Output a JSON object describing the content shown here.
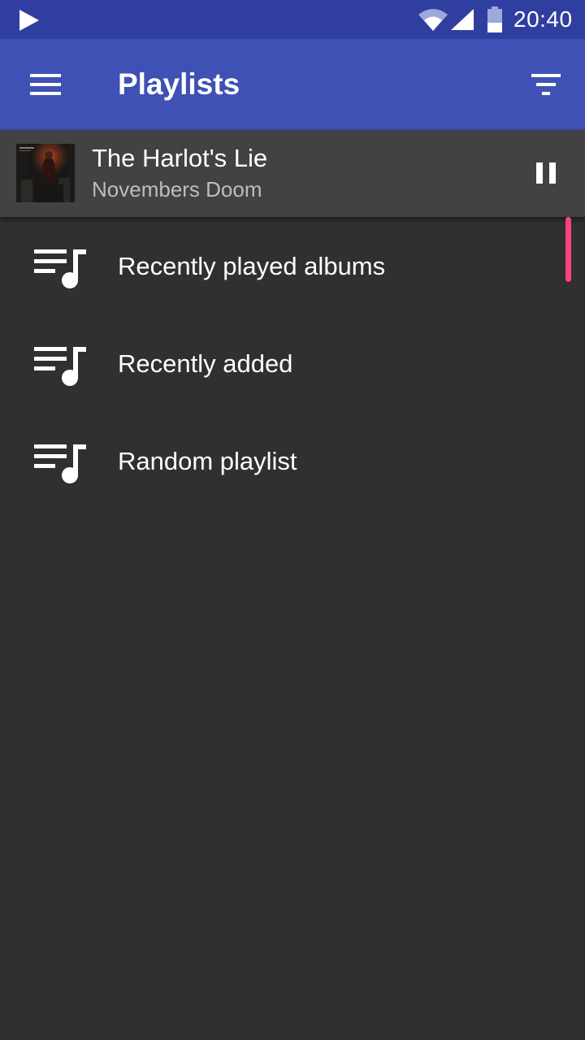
{
  "status_bar": {
    "time": "20:40",
    "icons": [
      "play-notification-icon",
      "wifi-icon",
      "signal-icon",
      "battery-icon"
    ]
  },
  "toolbar": {
    "title": "Playlists",
    "menu_icon": "hamburger-menu-icon",
    "sort_icon": "sort-filter-icon"
  },
  "now_playing": {
    "title": "The Harlot's Lie",
    "artist": "Novembers Doom",
    "control_icon": "pause-icon"
  },
  "playlists": [
    {
      "label": "Recently played albums",
      "icon": "playlist-music-icon"
    },
    {
      "label": "Recently added",
      "icon": "playlist-music-icon"
    },
    {
      "label": "Random playlist",
      "icon": "playlist-music-icon"
    }
  ],
  "colors": {
    "status_bar": "#303f9f",
    "toolbar": "#3f51b5",
    "background": "#303030",
    "now_playing_bg": "#424242",
    "accent": "#ff4081"
  }
}
